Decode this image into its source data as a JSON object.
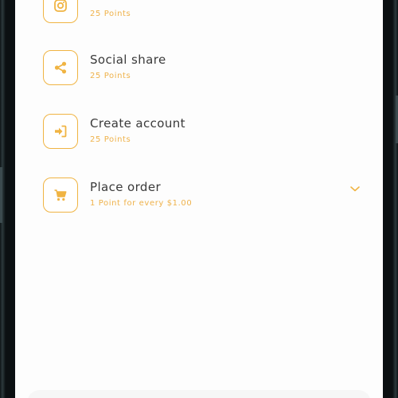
{
  "rewards": {
    "items": [
      {
        "title": "",
        "points": "25 Points",
        "icon": "instagram-icon"
      },
      {
        "title": "Social share",
        "points": "25 Points",
        "icon": "share-icon"
      },
      {
        "title": "Create account",
        "points": "25 Points",
        "icon": "sign-in-icon"
      },
      {
        "title": "Place order",
        "points": "1 Point for every $1.00",
        "icon": "cart-icon",
        "expandable": true
      }
    ]
  },
  "colors": {
    "accent": "#f0b443",
    "text": "#3a3a3a",
    "screen_bg": "#fdfdfd"
  }
}
